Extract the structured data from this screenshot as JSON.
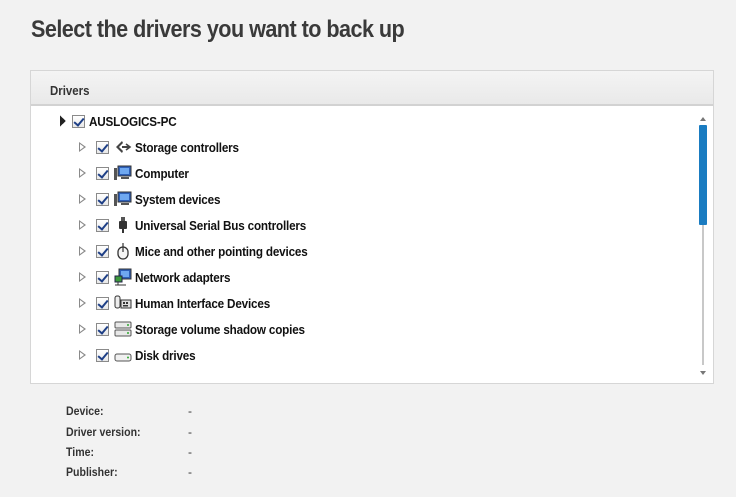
{
  "heading": "Select the drivers you want to back up",
  "panel": {
    "header": "Drivers",
    "root": {
      "label": "AUSLOGICS-PC",
      "checked": true,
      "expanded": true
    },
    "items": [
      {
        "label": "Storage controllers",
        "icon": "storage-controller-icon",
        "checked": true
      },
      {
        "label": "Computer",
        "icon": "computer-icon",
        "checked": true
      },
      {
        "label": "System devices",
        "icon": "system-devices-icon",
        "checked": true
      },
      {
        "label": "Universal Serial Bus controllers",
        "icon": "usb-plug-icon",
        "checked": true
      },
      {
        "label": "Mice and other pointing devices",
        "icon": "mouse-icon",
        "checked": true
      },
      {
        "label": "Network adapters",
        "icon": "network-adapter-icon",
        "checked": true
      },
      {
        "label": "Human Interface Devices",
        "icon": "hid-icon",
        "checked": true
      },
      {
        "label": "Storage volume shadow copies",
        "icon": "shadow-copy-drive-icon",
        "checked": true
      },
      {
        "label": "Disk drives",
        "icon": "disk-drive-icon",
        "checked": true
      }
    ]
  },
  "details": {
    "device_label": "Device:",
    "device_value": "-",
    "driver_version_label": "Driver version:",
    "driver_version_value": "-",
    "time_label": "Time:",
    "time_value": "-",
    "publisher_label": "Publisher:",
    "publisher_value": "-"
  },
  "colors": {
    "scroll_thumb": "#1a7cc1",
    "check_mark": "#1e3f86",
    "background": "#f2f2f2"
  }
}
